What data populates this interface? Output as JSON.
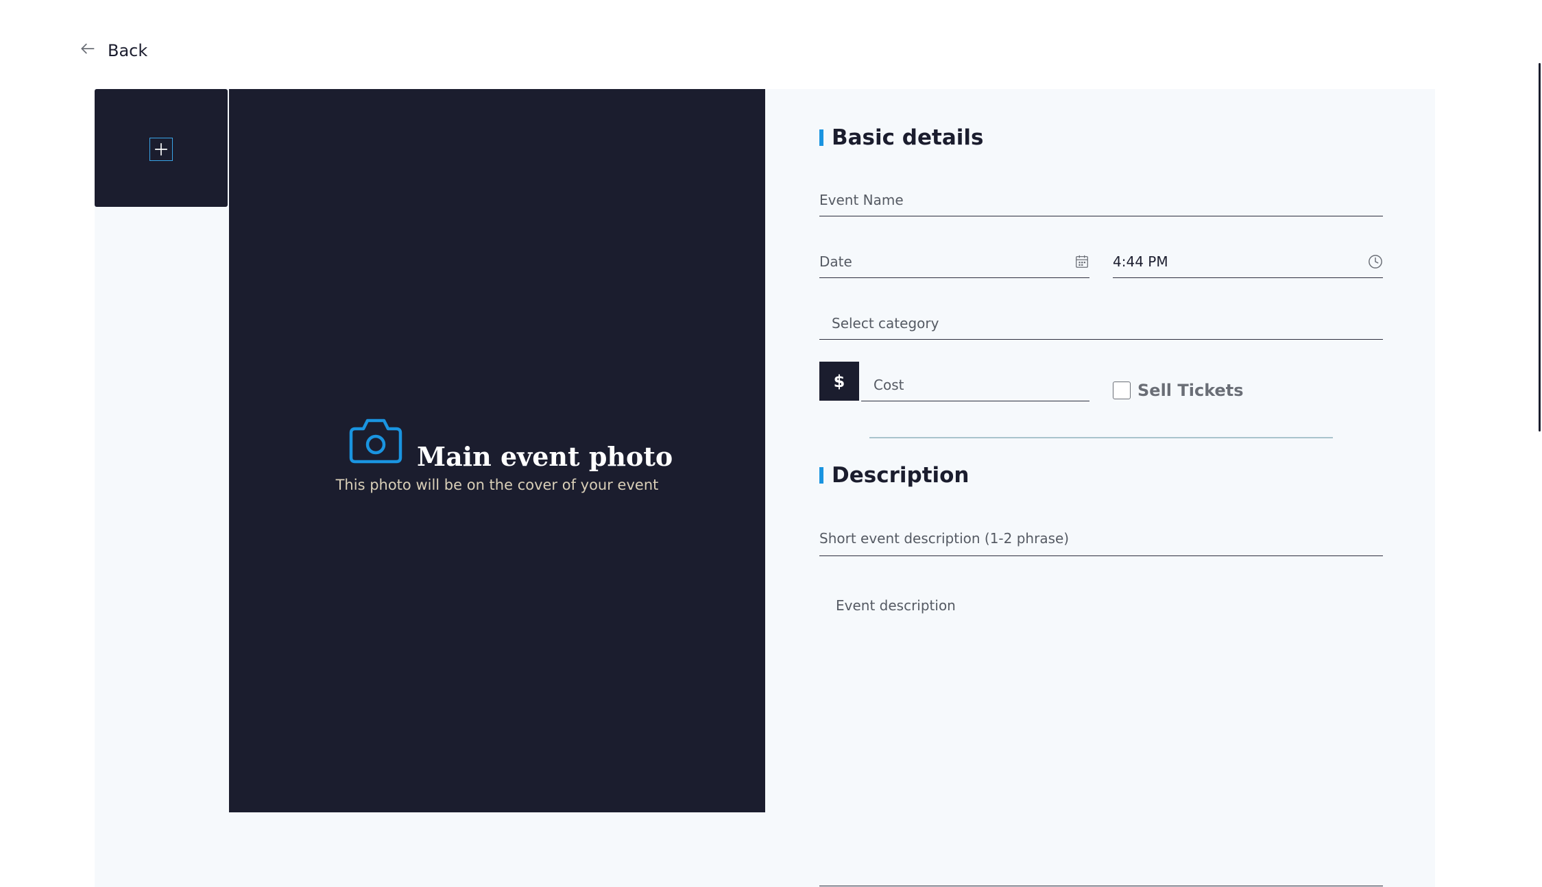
{
  "nav": {
    "back_label": "Back",
    "back_icon": "arrow-left-icon"
  },
  "gallery": {
    "add_icon": "plus-icon"
  },
  "main_photo": {
    "icon": "camera-icon",
    "title": "Main event photo",
    "subtitle": "This photo will be on the cover of your event"
  },
  "basic_details": {
    "title": "Basic details",
    "event_name_placeholder": "Event Name",
    "date_placeholder": "Date",
    "date_icon": "calendar-icon",
    "time_value": "4:44 PM",
    "time_icon": "clock-icon",
    "category_placeholder": "Select category",
    "currency_symbol": "$",
    "cost_placeholder": "Cost",
    "sell_tickets_label": "Sell Tickets",
    "sell_tickets_checked": false
  },
  "description": {
    "title": "Description",
    "short_placeholder": "Short event description (1-2 phrase)",
    "long_placeholder": "Event description"
  },
  "colors": {
    "dark_panel": "#1b1d2e",
    "accent": "#1a94e0",
    "card_bg": "#f6f9fc"
  }
}
